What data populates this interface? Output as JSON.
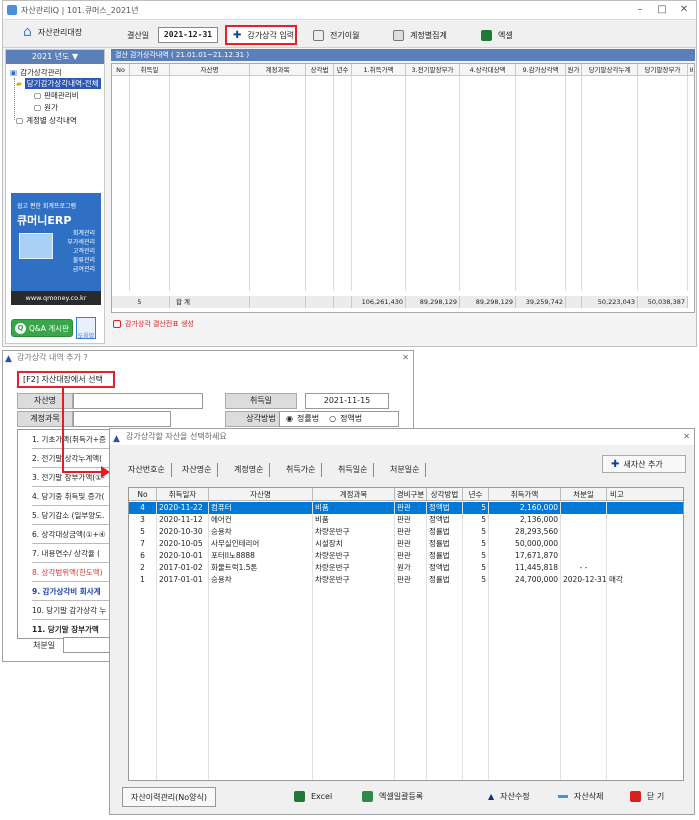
{
  "main": {
    "title": "자산관리IQ | 101.큐머스_2021년",
    "toolbar": {
      "asset_ledger": "자산관리대장",
      "settle_date_label": "결산일",
      "settle_date_value": "2021-12-31",
      "depreciation_input": "감가상각 입력",
      "prev_transfer": "전기이월",
      "account_summary": "계정별집계",
      "excel": "엑셀"
    },
    "year_selector": "2021 년도 ▼",
    "tree": {
      "root": "감가상각관리",
      "current": "당기감가상각내역-전체",
      "child1": "판매관리비",
      "child2": "원가",
      "account_detail": "계정별 상각내역"
    },
    "ad": {
      "line1": "쉽고 편한 회계프로그램",
      "brand": "큐머니ERP",
      "items": [
        "회계관리",
        "부가세관리",
        "고객관리",
        "물류관리",
        "급여관리"
      ],
      "url": "www.qmoney.co.kr"
    },
    "qa_button": "Q&A 게시판",
    "help_button": "도움말",
    "sub_header": "결산 감가상각내역 ( 21.01.01~21.12.31 )",
    "grid_headers": [
      "No",
      "취득일",
      "자산명",
      "계정과목",
      "상각법",
      "년수",
      "1.취득가액",
      "3.전기말장부가",
      "4.상각대상액",
      "9.감가상각액",
      "원가",
      "당기말상각누계",
      "당기말장부가",
      "비"
    ],
    "totals": {
      "count": "5",
      "label": "합 계",
      "acq": "106,261,430",
      "prev_book": "89,298,129",
      "base": "89,298,129",
      "dep": "39,259,742",
      "accum": "50,223,043",
      "book": "50,038,387"
    },
    "gen_link": "감가상각 결산전표 생성"
  },
  "dlg1": {
    "title": "감가상각 내역 추가 ?",
    "f2_button": "[F2] 자산대장에서 선택",
    "asset_name_label": "자산명",
    "acq_date_label": "취득일",
    "acq_date_value": "2021-11-15",
    "account_label": "계정과목",
    "method_label": "상각방법",
    "method_fixed": "정률법",
    "method_straight": "정액법",
    "rows": [
      "1. 기초가액(취득가+증",
      "2. 전기말 상각누계액(",
      "3. 전기말 장부가액(①-",
      "4. 당기중 취득및 증가(",
      "5. 당기감소 (일부양도.",
      "6. 상각대상금액(①+④",
      "7. 내용연수/ 상각율 (",
      "8. 상각범위액(한도액)",
      "9. 감가상각비 회사계",
      "10. 당기말 감가상각 누",
      "11. 당기말 장부가액"
    ],
    "disposal_label": "처분일"
  },
  "dlg2": {
    "title": "감가상각할 자산을 선택하세요",
    "tabs": [
      "자산번호순",
      "자산명순",
      "계정명순",
      "취득가순",
      "취득일순",
      "처분일순"
    ],
    "add_asset": "새자산 추가",
    "headers": [
      "No",
      "취득일자",
      "자산명",
      "계정과목",
      "경비구분",
      "상각방법",
      "년수",
      "취득가액",
      "처분일",
      "비고"
    ],
    "rows": [
      [
        "4",
        "2020-11-22",
        "컴퓨터",
        "비품",
        "판관",
        "정액법",
        "5",
        "2,160,000",
        "",
        ""
      ],
      [
        "3",
        "2020-11-12",
        "에어컨",
        "비품",
        "판관",
        "정액법",
        "5",
        "2,136,000",
        "",
        ""
      ],
      [
        "5",
        "2020-10-30",
        "승용차",
        "차량운반구",
        "판관",
        "정률법",
        "5",
        "28,293,560",
        "",
        ""
      ],
      [
        "7",
        "2020-10-05",
        "사무실인테리어",
        "시설장치",
        "판관",
        "정률법",
        "5",
        "50,000,000",
        "",
        ""
      ],
      [
        "6",
        "2020-10-01",
        "포터ll노8888",
        "차량운반구",
        "판관",
        "정률법",
        "5",
        "17,671,870",
        "",
        ""
      ],
      [
        "2",
        "2017-01-02",
        "화물트럭1.5톤",
        "차량운반구",
        "원가",
        "정액법",
        "5",
        "11,445,818",
        "- -",
        ""
      ],
      [
        "1",
        "2017-01-01",
        "승용차",
        "차량운반구",
        "판관",
        "정률법",
        "5",
        "24,700,000",
        "2020-12-31",
        "매각"
      ]
    ],
    "history_btn": "자산이력관리(No양식)",
    "excel": "Excel",
    "excel_upload": "엑셀일괄등록",
    "edit": "자산수정",
    "delete": "자산삭제",
    "close": "닫 기"
  }
}
